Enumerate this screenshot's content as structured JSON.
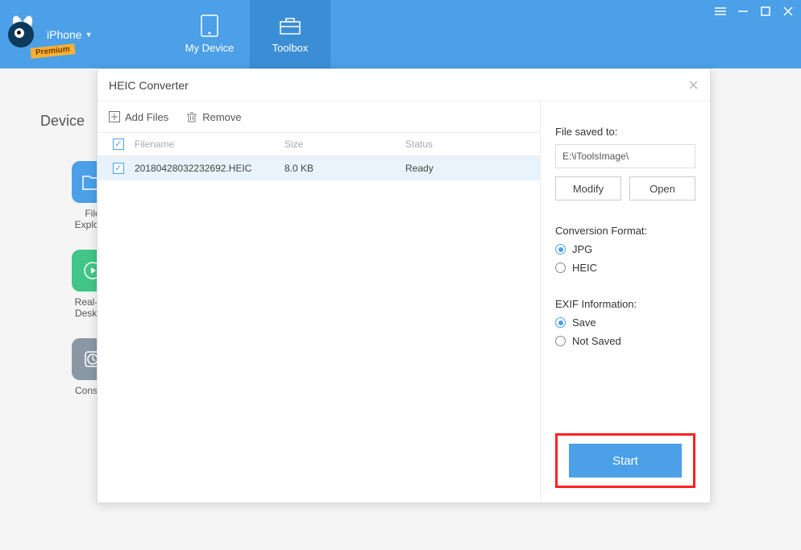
{
  "topbar": {
    "device_name": "iPhone",
    "premium_badge": "Premium",
    "tabs": {
      "my_device": "My Device",
      "toolbox": "Toolbox"
    }
  },
  "section_title": "Device",
  "sidebar_tools": {
    "file_explorer": "File\nExplorer",
    "realtime_desktop": "Real-tim\nDesktop",
    "console": "Console"
  },
  "dialog": {
    "title": "HEIC Converter",
    "toolbar": {
      "add_files": "Add Files",
      "remove": "Remove"
    },
    "columns": {
      "filename": "Filename",
      "size": "Size",
      "status": "Status"
    },
    "rows": [
      {
        "checked": true,
        "filename": "20180428032232692.HEIC",
        "size": "8.0 KB",
        "status": "Ready"
      }
    ],
    "right": {
      "saved_to_label": "File saved to:",
      "saved_to_path": "E:\\iToolsImage\\",
      "modify": "Modify",
      "open": "Open",
      "format_label": "Conversion Format:",
      "format_options": {
        "jpg": "JPG",
        "heic": "HEIC"
      },
      "format_selected": "jpg",
      "exif_label": "EXIF Information:",
      "exif_options": {
        "save": "Save",
        "not_saved": "Not Saved"
      },
      "exif_selected": "save",
      "start": "Start"
    }
  }
}
